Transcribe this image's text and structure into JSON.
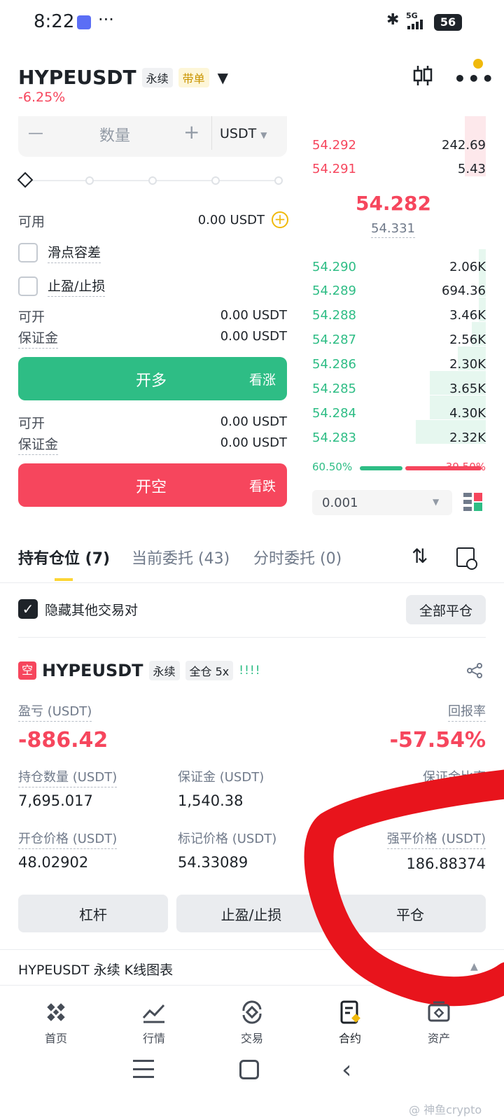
{
  "status_bar": {
    "time": "8:22",
    "dots": "···",
    "network": "5G",
    "battery": "56"
  },
  "header": {
    "symbol": "HYPEUSDT",
    "type_tag": "永续",
    "copy_tag": "带单",
    "change": "-6.25%"
  },
  "order_form": {
    "qty_placeholder": "数量",
    "minus": "—",
    "plus": "+",
    "unit": "USDT",
    "available_label": "可用",
    "available_value": "0.00 USDT",
    "slippage_label": "滑点容差",
    "tpsl_label": "止盈/止损",
    "long": {
      "can_open_label": "可开",
      "can_open_value": "0.00 USDT",
      "margin_label": "保证金",
      "margin_value": "0.00 USDT",
      "button": "开多",
      "sub": "看涨"
    },
    "short": {
      "can_open_label": "可开",
      "can_open_value": "0.00 USDT",
      "margin_label": "保证金",
      "margin_value": "0.00 USDT",
      "button": "开空",
      "sub": "看跌"
    }
  },
  "orderbook": {
    "asks": [
      {
        "price": "54.292",
        "qty": "242.69"
      },
      {
        "price": "54.291",
        "qty": "5.43"
      }
    ],
    "last_price": "54.282",
    "mark_price": "54.331",
    "bids": [
      {
        "price": "54.290",
        "qty": "2.06K"
      },
      {
        "price": "54.289",
        "qty": "694.36"
      },
      {
        "price": "54.288",
        "qty": "3.46K"
      },
      {
        "price": "54.287",
        "qty": "2.56K"
      },
      {
        "price": "54.286",
        "qty": "2.30K"
      },
      {
        "price": "54.285",
        "qty": "3.65K"
      },
      {
        "price": "54.284",
        "qty": "4.30K"
      },
      {
        "price": "54.283",
        "qty": "2.32K"
      }
    ],
    "buy_pct": "60.50%",
    "sell_pct": "39.50%",
    "buy_ratio": 0.605,
    "precision": "0.001"
  },
  "tabs": [
    {
      "label": "持有仓位 (7)",
      "active": true
    },
    {
      "label": "当前委托 (43)"
    },
    {
      "label": "分时委托 (0)"
    }
  ],
  "positions_bar": {
    "hide_label": "隐藏其他交易对",
    "close_all": "全部平仓"
  },
  "position": {
    "side_tag": "空",
    "symbol": "HYPEUSDT",
    "type_tag": "永续",
    "mode_tag": "全仓 5x",
    "signal": "!!!!",
    "pnl_label": "盈亏 (USDT)",
    "pnl_value": "-886.42",
    "roe_label": "回报率",
    "roe_value": "-57.54%",
    "size_label": "持仓数量 (USDT)",
    "size_value": "7,695.017",
    "margin_label": "保证金 (USDT)",
    "margin_value": "1,540.38",
    "margin_ratio_label": "保证金比率",
    "entry_label": "开仓价格 (USDT)",
    "entry_value": "48.02902",
    "mark_label": "标记价格 (USDT)",
    "mark_value": "54.33089",
    "liq_label": "强平价格 (USDT)",
    "liq_value": "186.88374",
    "buttons": {
      "leverage": "杠杆",
      "tpsl": "止盈/止损",
      "close": "平仓"
    }
  },
  "kline_bar": {
    "label": "HYPEUSDT 永续 K线图表"
  },
  "bottom_nav": [
    {
      "label": "首页",
      "icon": "home-icon"
    },
    {
      "label": "行情",
      "icon": "markets-icon"
    },
    {
      "label": "交易",
      "icon": "trade-icon"
    },
    {
      "label": "合约",
      "icon": "futures-icon",
      "active": true
    },
    {
      "label": "资产",
      "icon": "wallet-icon"
    }
  ],
  "watermark": "@ 神鱼crypto",
  "colors": {
    "green": "#2ebd85",
    "red": "#f6465d",
    "yellow": "#fcd535",
    "annotation": "#e8141c"
  }
}
